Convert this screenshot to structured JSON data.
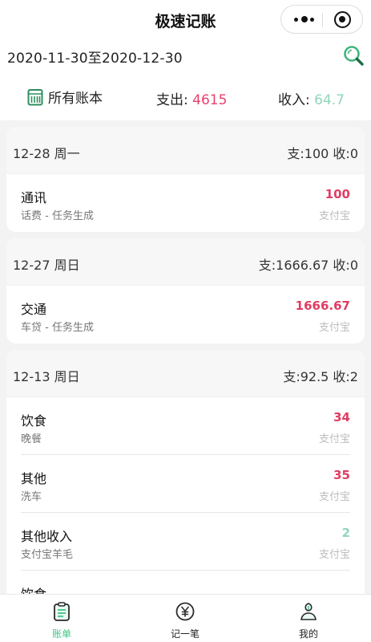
{
  "app": {
    "title": "极速记账"
  },
  "header": {
    "date_range": "2020-11-30至2020-12-30",
    "ledger_label": "所有账本",
    "expense_label": "支出:",
    "expense_value": "4615",
    "income_label": "收入:",
    "income_value": "64.7"
  },
  "groups": [
    {
      "date": "12-28 周一",
      "totals": "支:100 收:0",
      "items": [
        {
          "category": "通讯",
          "note": "话费 - 任务生成",
          "amount": "100",
          "account": "支付宝",
          "kind": "expense"
        }
      ]
    },
    {
      "date": "12-27 周日",
      "totals": "支:1666.67 收:0",
      "items": [
        {
          "category": "交通",
          "note": "车贷 - 任务生成",
          "amount": "1666.67",
          "account": "支付宝",
          "kind": "expense"
        }
      ]
    },
    {
      "date": "12-13 周日",
      "totals": "支:92.5 收:2",
      "items": [
        {
          "category": "饮食",
          "note": "晚餐",
          "amount": "34",
          "account": "支付宝",
          "kind": "expense"
        },
        {
          "category": "其他",
          "note": "洗车",
          "amount": "35",
          "account": "支付宝",
          "kind": "expense"
        },
        {
          "category": "其他收入",
          "note": "支付宝羊毛",
          "amount": "2",
          "account": "支付宝",
          "kind": "income"
        },
        {
          "category": "饮食",
          "note": "",
          "amount": "",
          "account": "",
          "kind": "expense"
        }
      ]
    }
  ],
  "tabs": [
    {
      "label": "账单",
      "active": true,
      "icon": "bill-icon"
    },
    {
      "label": "记一笔",
      "active": false,
      "icon": "yuan-icon"
    },
    {
      "label": "我的",
      "active": false,
      "icon": "profile-icon"
    }
  ],
  "colors": {
    "expense": "#e03c62",
    "income": "#8fd6ba",
    "accent": "#3fc488"
  }
}
